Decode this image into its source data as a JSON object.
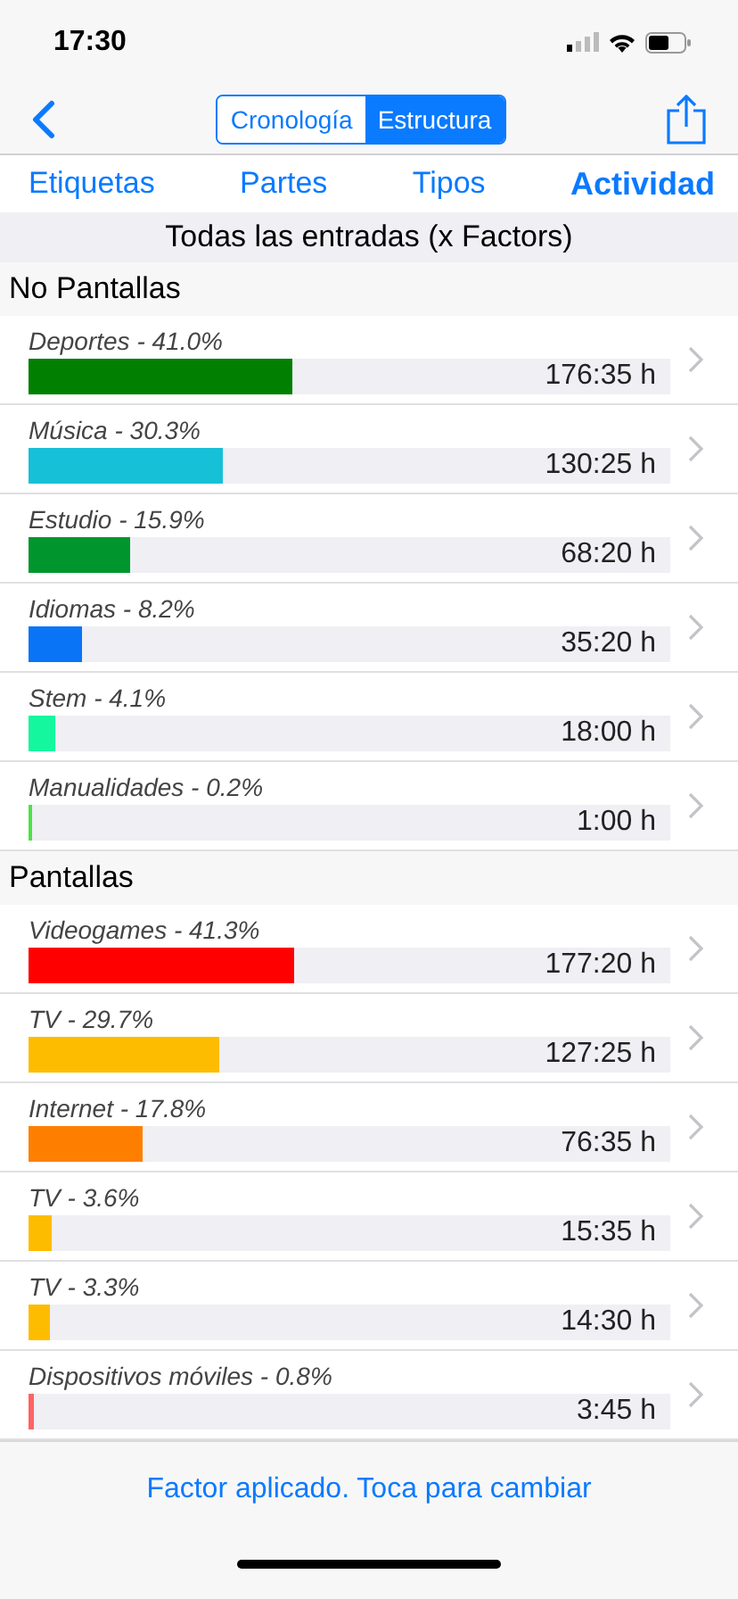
{
  "status_bar": {
    "time": "17:30"
  },
  "nav": {
    "segments": [
      {
        "label": "Cronología",
        "selected": false
      },
      {
        "label": "Estructura",
        "selected": true
      }
    ]
  },
  "tabs": [
    {
      "label": "Etiquetas",
      "selected": false
    },
    {
      "label": "Partes",
      "selected": false
    },
    {
      "label": "Tipos",
      "selected": false
    },
    {
      "label": "Actividad",
      "selected": true
    }
  ],
  "header": "Todas las entradas (x Factors)",
  "sections": [
    {
      "title": "No Pantallas",
      "rows": [
        {
          "label": "Deportes - 41.0%",
          "level": 0.41,
          "color": "#007f00",
          "time": "176:35 h"
        },
        {
          "label": "Música - 30.3%",
          "level": 0.303,
          "color": "#16c0d6",
          "time": "130:25 h"
        },
        {
          "label": "Estudio - 15.9%",
          "level": 0.159,
          "color": "#00962d",
          "time": "68:20 h"
        },
        {
          "label": "Idiomas - 8.2%",
          "level": 0.082,
          "color": "#0a74f7",
          "time": "35:20 h"
        },
        {
          "label": "Stem - 4.1%",
          "level": 0.041,
          "color": "#14f79e",
          "time": "18:00 h"
        },
        {
          "label": "Manualidades - 0.2%",
          "level": 0.002,
          "color": "#4be344",
          "time": "1:00 h"
        }
      ]
    },
    {
      "title": "Pantallas",
      "rows": [
        {
          "label": "Videogames - 41.3%",
          "level": 0.413,
          "color": "#fe0000",
          "time": "177:20 h"
        },
        {
          "label": "TV - 29.7%",
          "level": 0.297,
          "color": "#febc00",
          "time": "127:25 h"
        },
        {
          "label": "Internet - 17.8%",
          "level": 0.178,
          "color": "#fe7f00",
          "time": "76:35 h"
        },
        {
          "label": "TV - 3.6%",
          "level": 0.036,
          "color": "#febc00",
          "time": "15:35 h"
        },
        {
          "label": "TV - 3.3%",
          "level": 0.033,
          "color": "#febc00",
          "time": "14:30 h"
        },
        {
          "label": "Dispositivos móviles - 0.8%",
          "level": 0.008,
          "color": "#fe6363",
          "time": "3:45 h"
        }
      ]
    }
  ],
  "footer": "Factor aplicado. Toca para cambiar"
}
